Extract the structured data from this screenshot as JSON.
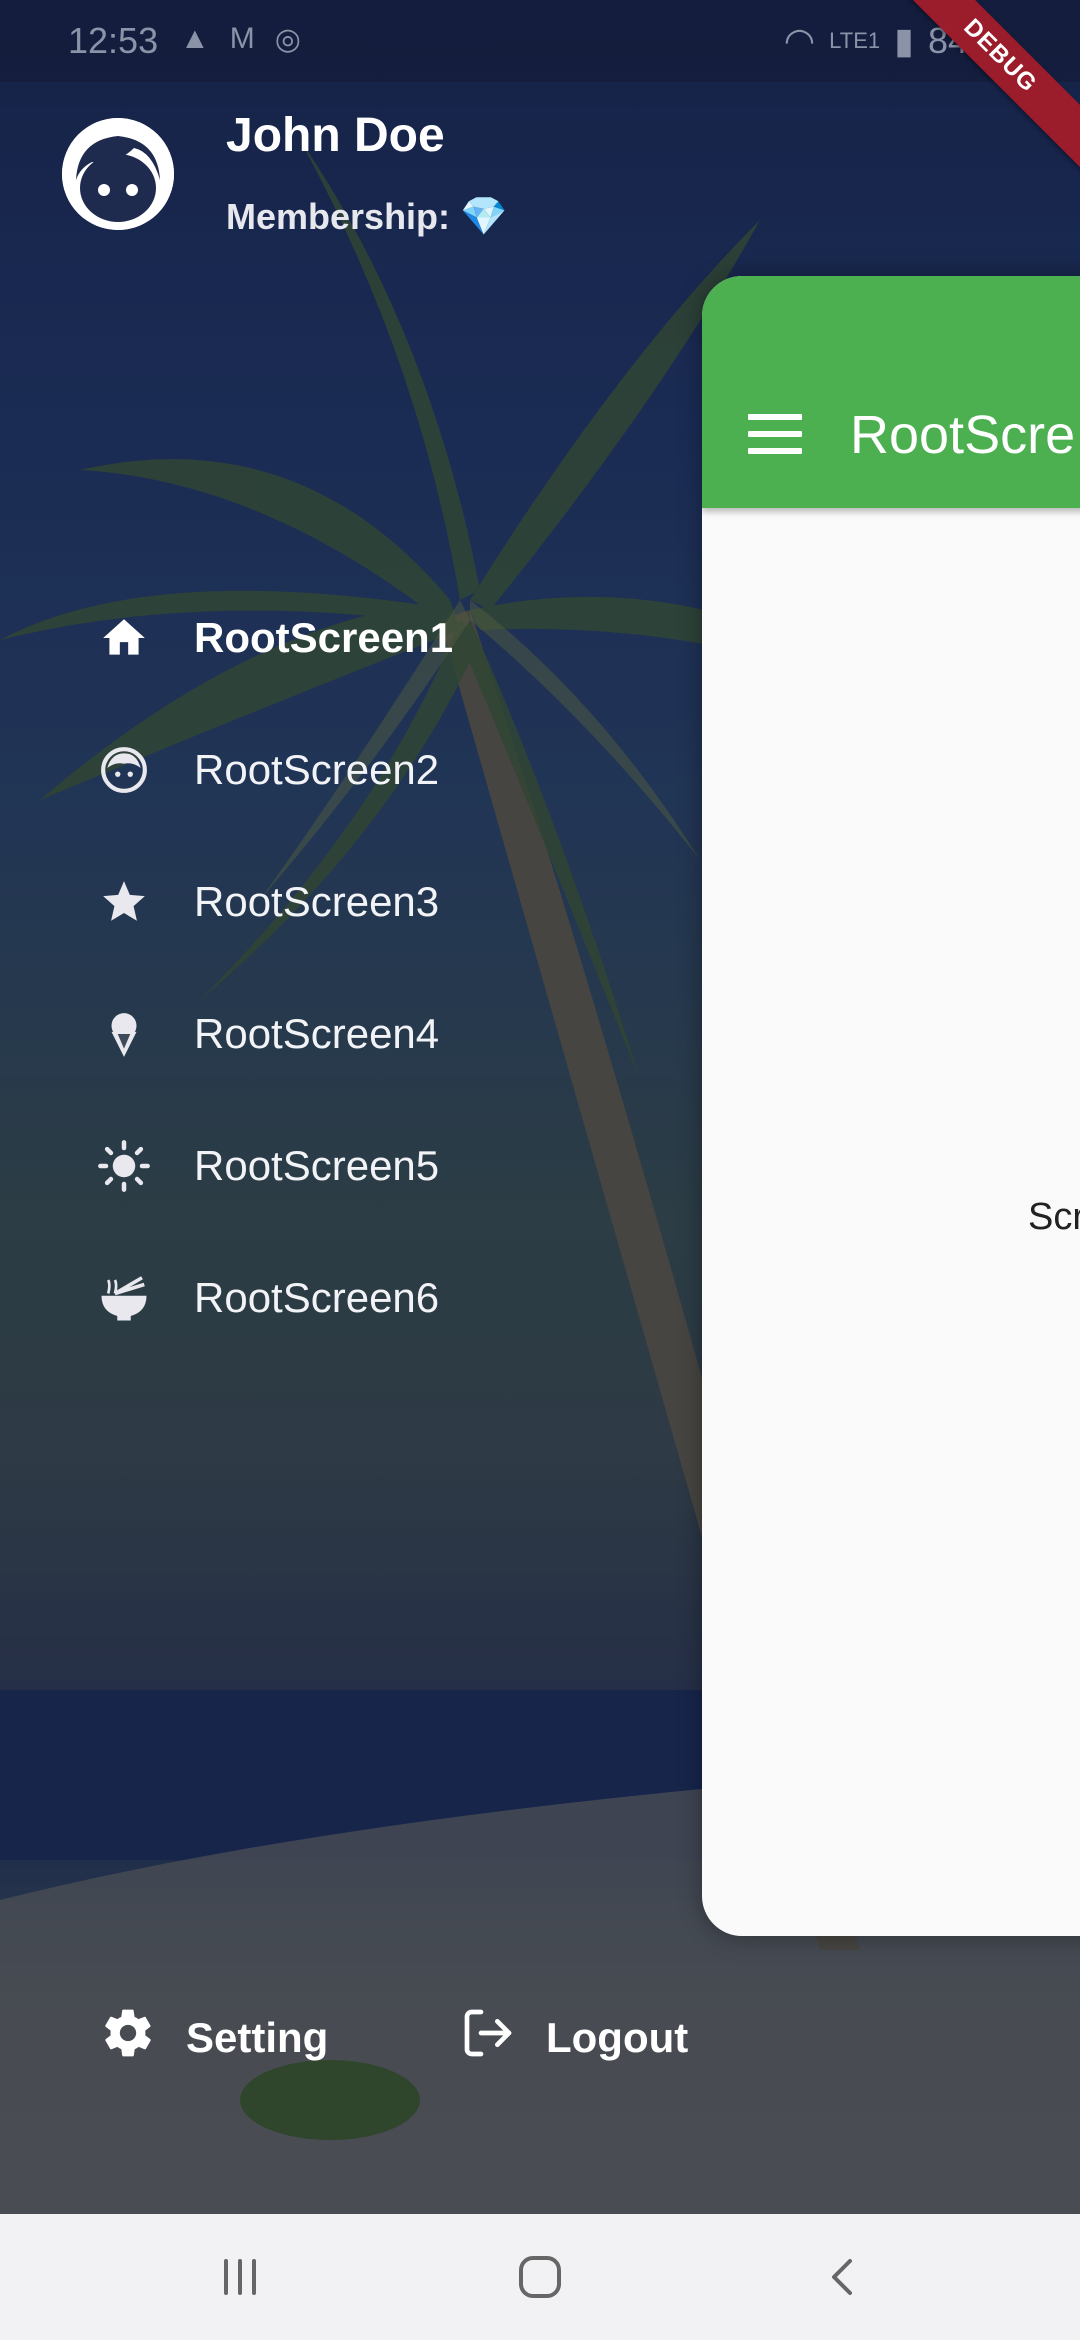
{
  "status_bar": {
    "time": "12:53",
    "battery": "84%",
    "debug_banner": "DEBUG"
  },
  "drawer": {
    "user_name": "John Doe",
    "membership_label": "Membership:",
    "menu": [
      {
        "label": "RootScreen1",
        "icon": "home-icon",
        "active": true
      },
      {
        "label": "RootScreen2",
        "icon": "face-icon",
        "active": false
      },
      {
        "label": "RootScreen3",
        "icon": "star-icon",
        "active": false
      },
      {
        "label": "RootScreen4",
        "icon": "ice-cream-icon",
        "active": false
      },
      {
        "label": "RootScreen5",
        "icon": "sun-icon",
        "active": false
      },
      {
        "label": "RootScreen6",
        "icon": "ramen-bowl-icon",
        "active": false
      }
    ],
    "setting_label": "Setting",
    "logout_label": "Logout"
  },
  "content": {
    "appbar_title": "RootScre",
    "body_text": "Scr",
    "appbar_color": "#4caf50"
  }
}
